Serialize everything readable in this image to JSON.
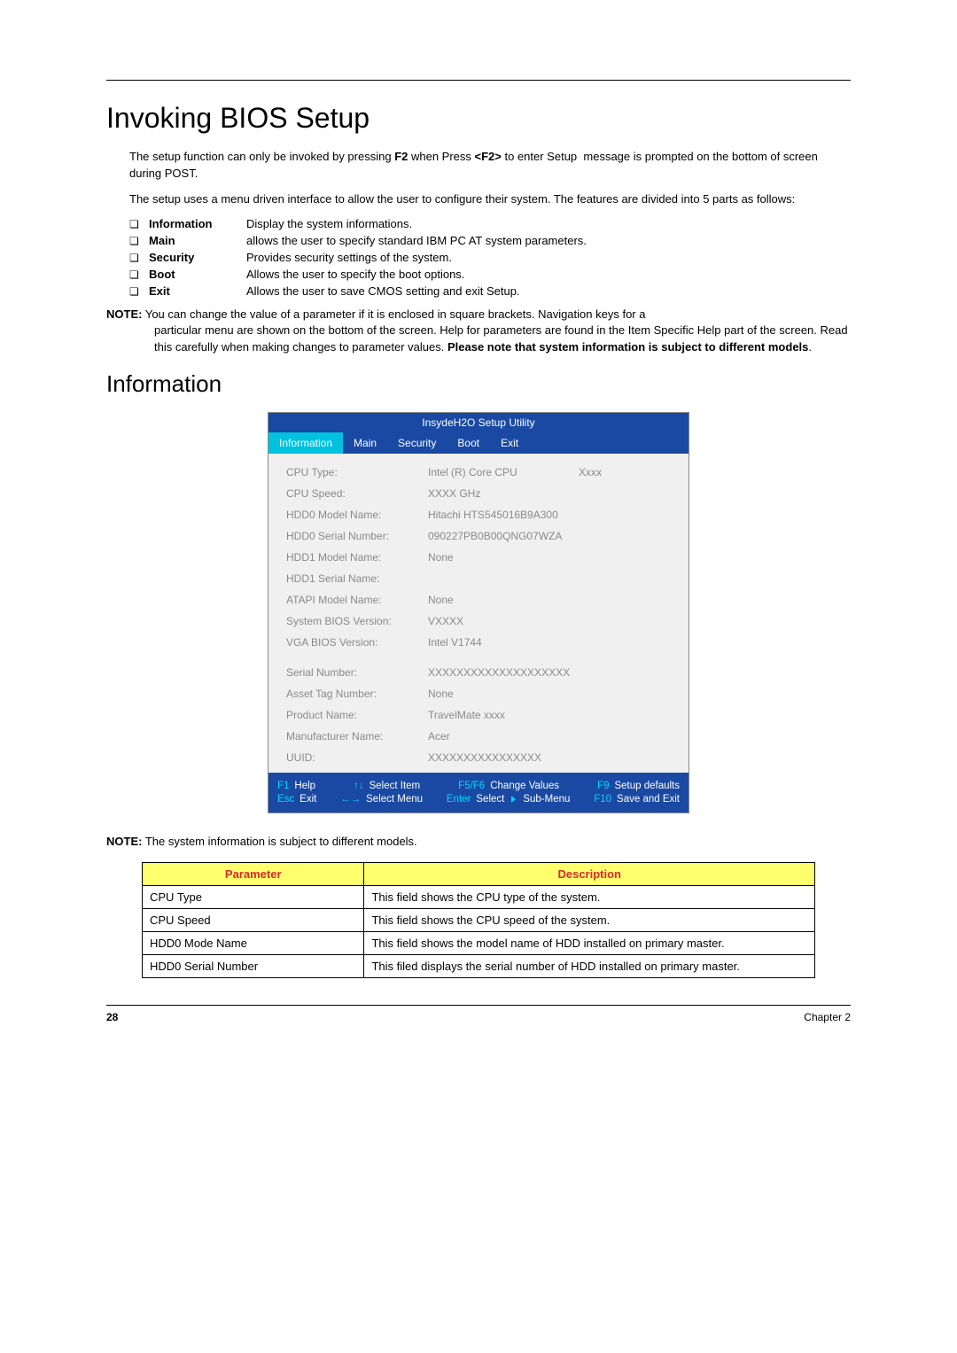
{
  "heading": "Invoking BIOS Setup",
  "intro1": "The setup function can only be invoked by pressing F2 when Press <F2> to enter Setup  message is prompted on the bottom of screen during POST.",
  "intro2": "The setup uses a menu driven interface to allow the user to configure their system. The features are divided into 5 parts as follows:",
  "parts": [
    {
      "label": "Information",
      "desc": "Display the system informations."
    },
    {
      "label": "Main",
      "desc": "allows the user to specify standard IBM PC AT system parameters."
    },
    {
      "label": "Security",
      "desc": "Provides security settings of the system."
    },
    {
      "label": "Boot",
      "desc": "Allows the user to specify the boot options."
    },
    {
      "label": "Exit",
      "desc": "Allows the user to save CMOS setting and exit Setup."
    }
  ],
  "note1_label": "NOTE:",
  "note1_first": " You can change the value of a parameter if it is enclosed in square brackets. Navigation keys for a",
  "note1_rest": "particular menu are shown on the bottom of the screen. Help for parameters are found in the Item Specific Help part of the screen. Read this carefully when making changes to parameter values.",
  "note1_bold": "Please note that system information is subject to different models",
  "note1_end": ".",
  "section": "Information",
  "bios": {
    "title": "InsydeH2O Setup Utility",
    "tabs": [
      "Information",
      "Main",
      "Security",
      "Boot",
      "Exit"
    ],
    "rows": [
      {
        "label": "CPU Type:",
        "value": "Intel (R) Core CPU",
        "extra": "Xxxx"
      },
      {
        "label": "CPU Speed:",
        "value": "XXXX GHz",
        "extra": ""
      },
      {
        "label": "HDD0 Model Name:",
        "value": "Hitachi HTS545016B9A300",
        "extra": ""
      },
      {
        "label": "HDD0 Serial Number:",
        "value": "090227PB0B00QNG07WZA",
        "extra": ""
      },
      {
        "label": "HDD1 Model Name:",
        "value": "None",
        "extra": ""
      },
      {
        "label": "HDD1 Serial Name:",
        "value": "",
        "extra": ""
      },
      {
        "label": "ATAPI Model Name:",
        "value": "None",
        "extra": ""
      },
      {
        "label": "System BIOS Version:",
        "value": "VXXXX",
        "extra": ""
      },
      {
        "label": "VGA BIOS Version:",
        "value": "Intel V1744",
        "extra": ""
      },
      {
        "label": "",
        "value": "",
        "extra": ""
      },
      {
        "label": "Serial Number:",
        "value": "XXXXXXXXXXXXXXXXXXXX",
        "extra": ""
      },
      {
        "label": "Asset Tag Number:",
        "value": "None",
        "extra": ""
      },
      {
        "label": "Product Name:",
        "value": "TravelMate xxxx",
        "extra": ""
      },
      {
        "label": "Manufacturer Name:",
        "value": "Acer",
        "extra": ""
      },
      {
        "label": "UUID:",
        "value": "XXXXXXXXXXXXXXXX",
        "extra": ""
      }
    ],
    "footer": {
      "r1": {
        "a_k": "F1",
        "a_t": "Help",
        "b_k": "↑↓",
        "b_t": "Select Item",
        "c_k": "F5/F6",
        "c_t": "Change Values",
        "d_k": "F9",
        "d_t": "Setup defaults"
      },
      "r2": {
        "a_k": "Esc",
        "a_t": "Exit",
        "b_k": "←→",
        "b_t": "Select Menu",
        "c_k": "Enter",
        "c_t": "Select",
        "c_t2": "Sub-Menu",
        "d_k": "F10",
        "d_t": "Save and Exit"
      }
    }
  },
  "note2_label": "NOTE:",
  "note2_text": " The system information is subject to different models.",
  "param_headers": {
    "p": "Parameter",
    "d": "Description"
  },
  "param_rows": [
    {
      "p": "CPU Type",
      "d": "This field shows the CPU type of the system."
    },
    {
      "p": "CPU Speed",
      "d": "This field shows the CPU speed of the system."
    },
    {
      "p": "HDD0 Mode Name",
      "d": "This field shows the model name of HDD installed on primary master."
    },
    {
      "p": "HDD0 Serial Number",
      "d": "This filed displays the serial number of HDD installed on primary master."
    }
  ],
  "footer": {
    "page": "28",
    "chapter": "Chapter 2"
  }
}
